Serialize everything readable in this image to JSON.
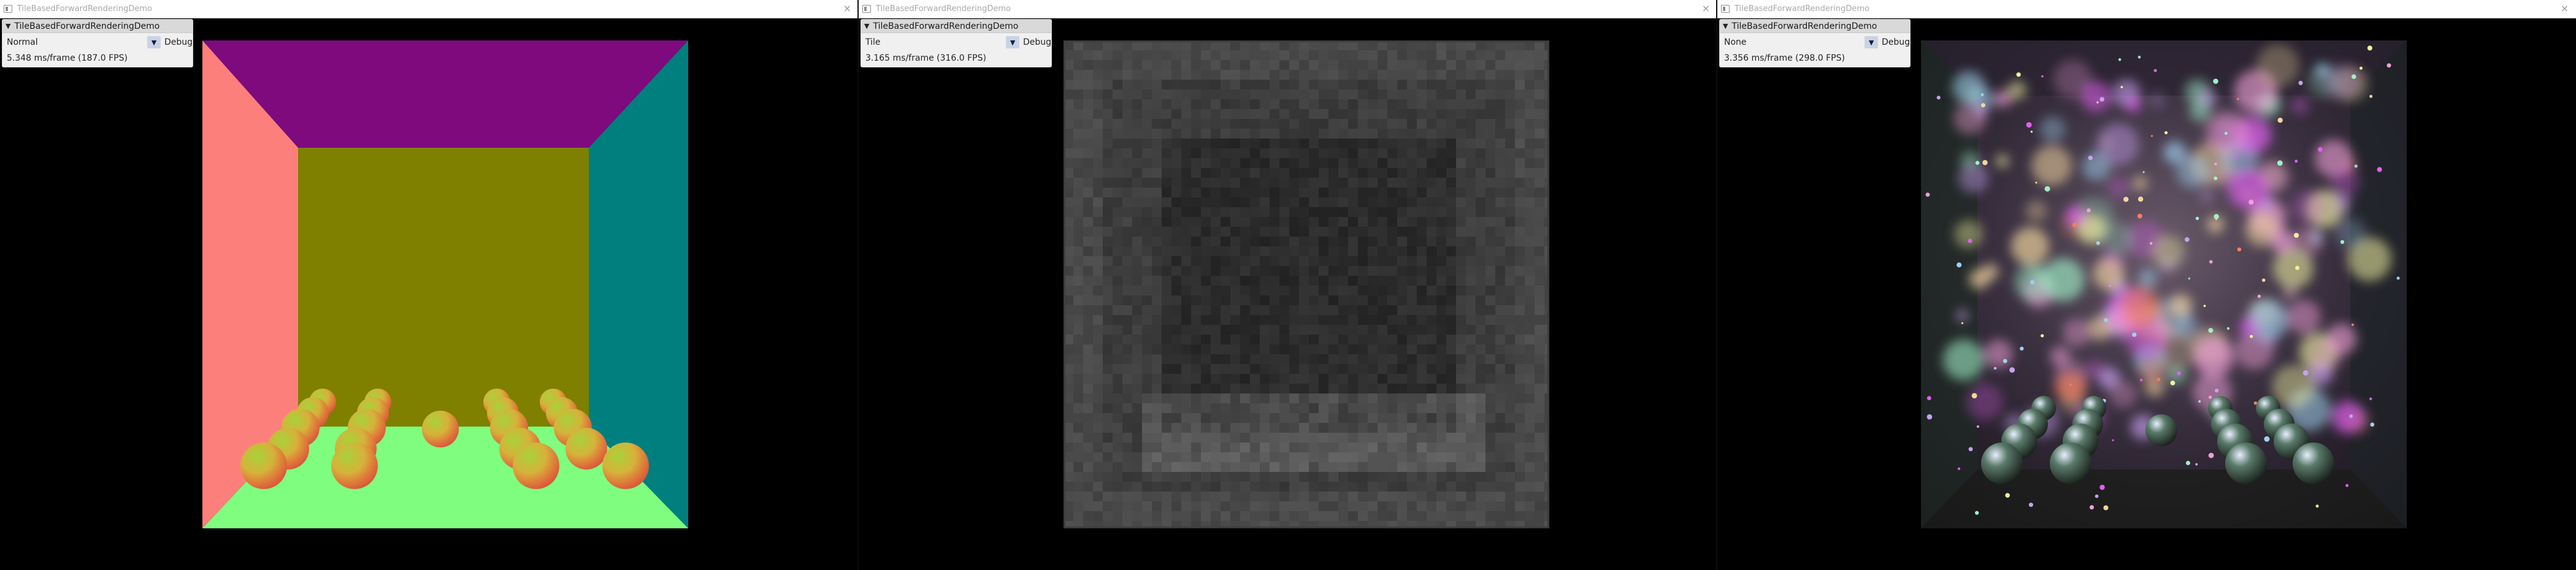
{
  "windows": [
    {
      "title": "TileBasedForwardRenderingDemo",
      "panel_title": "TileBasedForwardRenderingDemo",
      "mode": "Normal",
      "label": "Debug",
      "fps": "5.348 ms/frame (187.0 FPS)"
    },
    {
      "title": "TileBasedForwardRenderingDemo",
      "panel_title": "TileBasedForwardRenderingDemo",
      "mode": "Tile",
      "label": "Debug",
      "fps": "3.165 ms/frame (316.0 FPS)"
    },
    {
      "title": "TileBasedForwardRenderingDemo",
      "panel_title": "TileBasedForwardRenderingDemo",
      "mode": "None",
      "label": "Debug",
      "fps": "3.356 ms/frame (298.0 FPS)"
    }
  ],
  "icons": {
    "close": "×",
    "collapse": "▼",
    "combo": "▼"
  },
  "colors": {
    "ceiling": "#7e0a7e",
    "back_wall": "#7f7f00",
    "left_wall": "#fd7f7c",
    "right_wall": "#007f7f",
    "floor": "#7ffd7f"
  }
}
